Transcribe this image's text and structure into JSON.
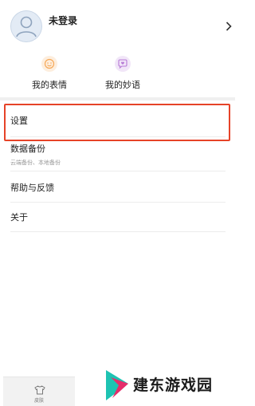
{
  "profile": {
    "username": "未登录"
  },
  "quick_actions": [
    {
      "label": "我的表情",
      "icon": "smiley-icon",
      "color": "#f6a857"
    },
    {
      "label": "我的妙语",
      "icon": "chat-heart-icon",
      "color": "#b77ad6"
    }
  ],
  "menu": [
    {
      "label": "设置"
    },
    {
      "label": "数据备份",
      "sub": "云端备份、本地备份"
    },
    {
      "label": "帮助与反馈"
    },
    {
      "label": "关于"
    }
  ],
  "tabbar": {
    "label": "皮肤",
    "icon": "tshirt-icon"
  },
  "watermark": {
    "text": "建东游戏园"
  },
  "colors": {
    "highlight": "#e64328",
    "divider": "#f0f0f0"
  }
}
